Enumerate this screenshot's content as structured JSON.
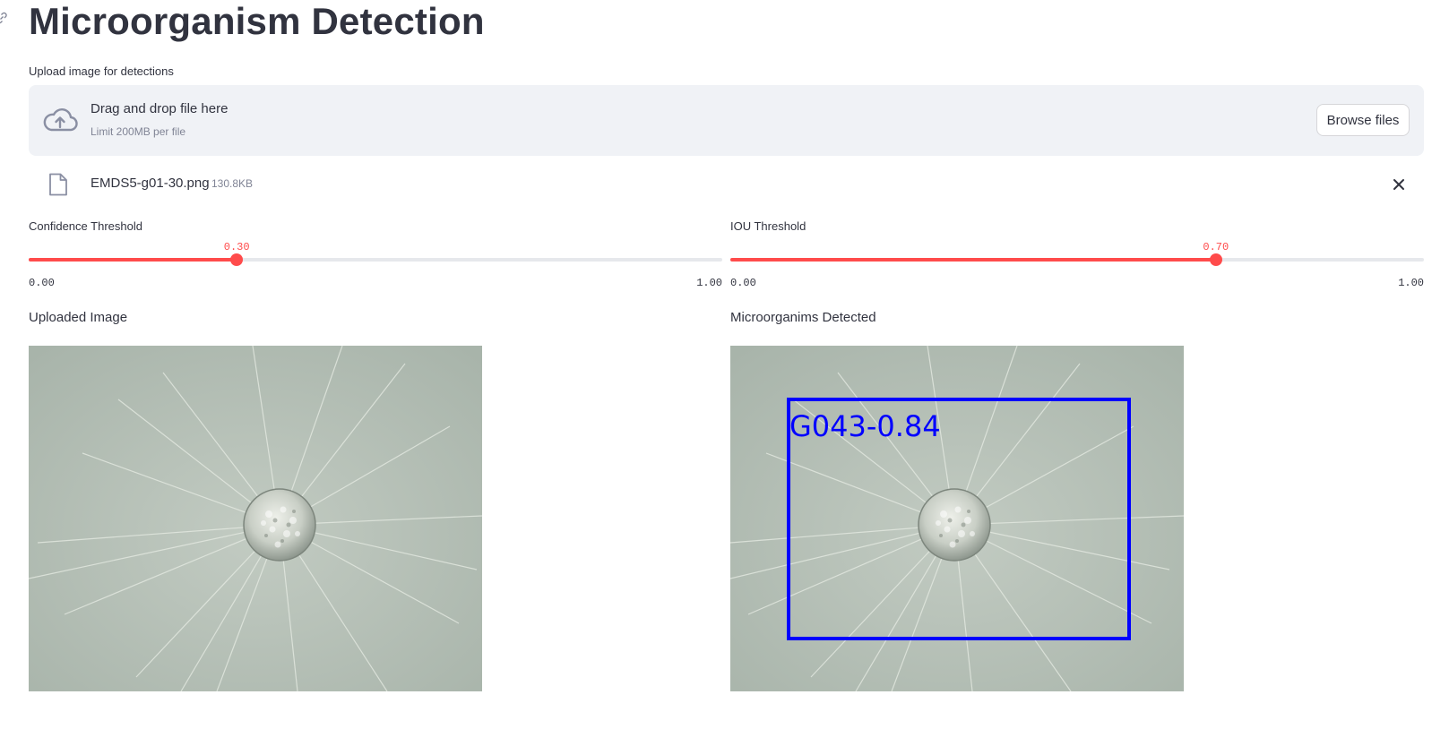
{
  "page": {
    "title": "Microorganism Detection"
  },
  "uploader": {
    "label": "Upload image for detections",
    "drag_text": "Drag and drop file here",
    "limit_text": "Limit 200MB per file",
    "browse_label": "Browse files",
    "icon": "cloud-upload-icon"
  },
  "file": {
    "name": "EMDS5-g01-30.png",
    "size": "130.8KB",
    "icon": "file-icon"
  },
  "sliders": {
    "confidence": {
      "label": "Confidence Threshold",
      "value": "0.30",
      "fraction": 0.3,
      "min": "0.00",
      "max": "1.00"
    },
    "iou": {
      "label": "IOU Threshold",
      "value": "0.70",
      "fraction": 0.7,
      "min": "0.00",
      "max": "1.00"
    }
  },
  "images": {
    "uploaded_caption": "Uploaded Image",
    "detected_caption": "Microorganims Detected",
    "detection_label": "G043-0.84"
  },
  "colors": {
    "accent": "#ff4b4b",
    "text": "#31333f",
    "muted": "#808495",
    "dropzone_bg": "#f0f2f6",
    "bbox": "#0000ff"
  }
}
